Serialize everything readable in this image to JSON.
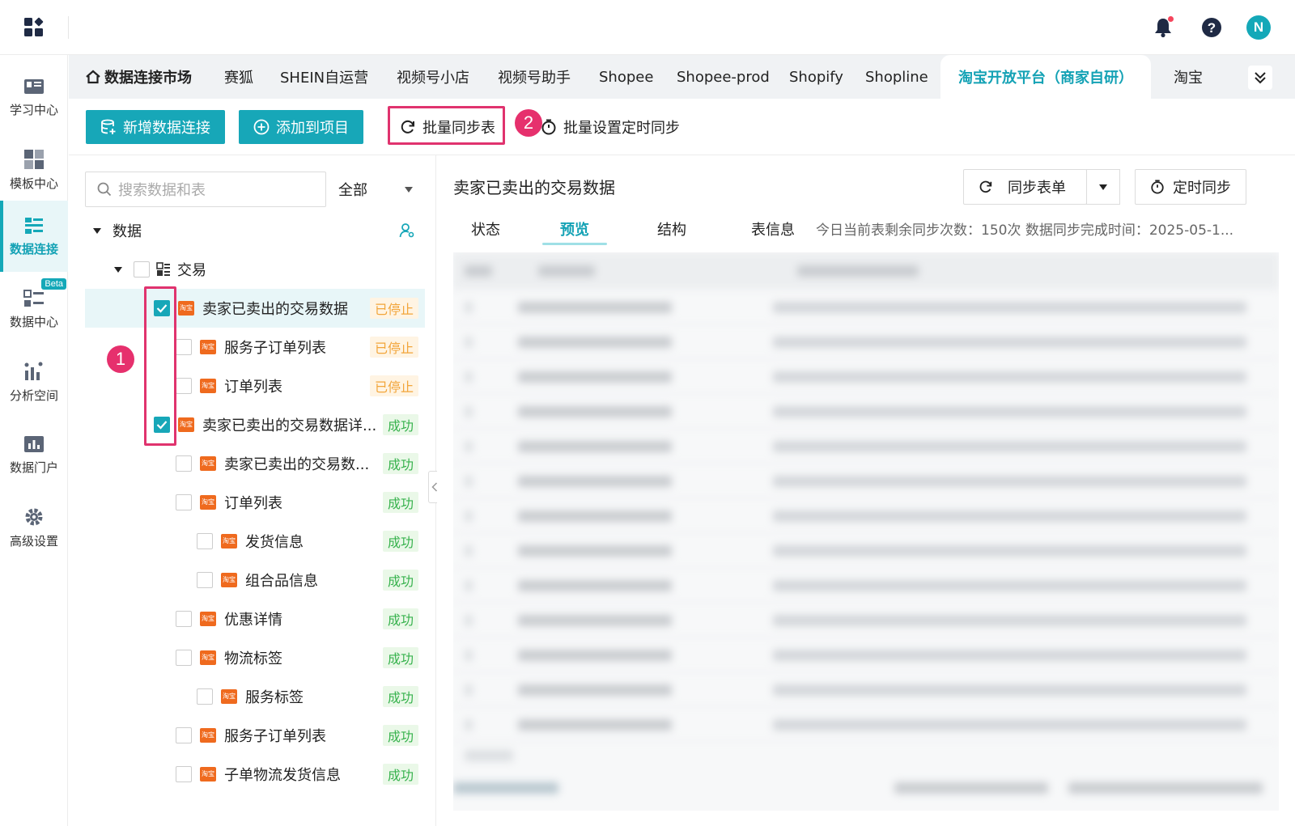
{
  "header": {
    "icons": [
      "apps-grid-icon",
      "bell-icon",
      "help-icon"
    ],
    "avatar_initial": "N"
  },
  "sidebar": {
    "items": [
      {
        "label": "学习中心",
        "icon": "learning-icon"
      },
      {
        "label": "模板中心",
        "icon": "template-icon"
      },
      {
        "label": "数据连接",
        "icon": "data-connect-icon",
        "active": true
      },
      {
        "label": "数据中心",
        "icon": "data-center-icon",
        "badge": "Beta"
      },
      {
        "label": "分析空间",
        "icon": "analysis-icon"
      },
      {
        "label": "数据门户",
        "icon": "portal-icon"
      },
      {
        "label": "高级设置",
        "icon": "gear-icon"
      }
    ]
  },
  "tabs": {
    "home": "数据连接市场",
    "items": [
      "赛狐",
      "SHEIN自运营",
      "视频号小店",
      "视频号助手",
      "Shopee",
      "Shopee-prod",
      "Shopify",
      "Shopline",
      "淘宝开放平台（商家自研）",
      "淘宝"
    ]
  },
  "toolbar": {
    "add_connection": "新增数据连接",
    "add_to_project": "添加到项目",
    "batch_sync": "批量同步表",
    "batch_schedule": "批量设置定时同步",
    "annotation_2": "2"
  },
  "tree": {
    "search_placeholder": "搜索数据和表",
    "filter": "全部",
    "root_label": "数据",
    "group_label": "交易",
    "annotation_1": "1",
    "status_stopped": "已停止",
    "status_ok": "成功",
    "rows": [
      {
        "label": "卖家已卖出的交易数据",
        "status": "已停止",
        "checked": true,
        "level": 1
      },
      {
        "label": "服务子订单列表",
        "status": "已停止",
        "checked": false,
        "level": 2
      },
      {
        "label": "订单列表",
        "status": "已停止",
        "checked": false,
        "level": 2
      },
      {
        "label": "卖家已卖出的交易数据详...",
        "status": "成功",
        "checked": true,
        "level": 1
      },
      {
        "label": "卖家已卖出的交易数...",
        "status": "成功",
        "checked": false,
        "level": 2
      },
      {
        "label": "订单列表",
        "status": "成功",
        "checked": false,
        "level": 2
      },
      {
        "label": "发货信息",
        "status": "成功",
        "checked": false,
        "level": 3
      },
      {
        "label": "组合品信息",
        "status": "成功",
        "checked": false,
        "level": 3
      },
      {
        "label": "优惠详情",
        "status": "成功",
        "checked": false,
        "level": 2
      },
      {
        "label": "物流标签",
        "status": "成功",
        "checked": false,
        "level": 2
      },
      {
        "label": "服务标签",
        "status": "成功",
        "checked": false,
        "level": 3
      },
      {
        "label": "服务子订单列表",
        "status": "成功",
        "checked": false,
        "level": 2
      },
      {
        "label": "子单物流发货信息",
        "status": "成功",
        "checked": false,
        "level": 2
      }
    ]
  },
  "panel": {
    "title": "卖家已卖出的交易数据",
    "sync_button": "同步表单",
    "schedule_button": "定时同步",
    "subtabs": [
      "状态",
      "预览",
      "结构"
    ],
    "active_subtab": "预览",
    "info_label": "表信息",
    "info_text": "今日当前表剩余同步次数：150次   数据同步完成时间：2025-05-1..."
  },
  "colors": {
    "accent": "#17a7b8",
    "annotation": "#e0336e",
    "stopped": "#f2a53a",
    "ok": "#37b24d"
  }
}
